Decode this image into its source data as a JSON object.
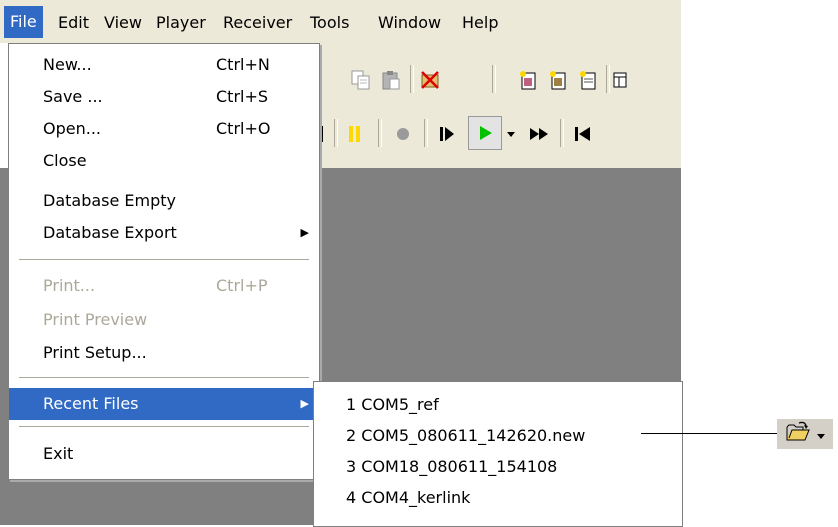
{
  "menubar": {
    "items": [
      "File",
      "Edit",
      "View",
      "Player",
      "Receiver",
      "Tools",
      "Window",
      "Help"
    ]
  },
  "file_menu": {
    "items": [
      {
        "label": "New...",
        "shortcut": "Ctrl+N"
      },
      {
        "label": "Save ...",
        "shortcut": "Ctrl+S"
      },
      {
        "label": "Open...",
        "shortcut": "Ctrl+O"
      },
      {
        "label": "Close",
        "shortcut": ""
      },
      {
        "label": "Database Empty",
        "shortcut": ""
      },
      {
        "label": "Database Export",
        "shortcut": ""
      },
      {
        "label": "Print...",
        "shortcut": "Ctrl+P"
      },
      {
        "label": "Print Preview",
        "shortcut": ""
      },
      {
        "label": "Print Setup...",
        "shortcut": ""
      },
      {
        "label": "Recent Files",
        "shortcut": ""
      },
      {
        "label": "Exit",
        "shortcut": ""
      }
    ]
  },
  "recent_files": [
    "1 COM5_ref",
    "2 COM5_080611_142620.new",
    "3 COM18_080611_154108",
    "4 COM4_kerlink"
  ],
  "colors": {
    "highlight": "#316ac5",
    "disabled": "#aca899",
    "workspace": "#808080",
    "chrome": "#ece9d8"
  },
  "icons": {
    "toolbar_row1": [
      "copy-icon",
      "paste-icon",
      "delete-icon",
      "new-document-icon",
      "new-document-2-icon",
      "new-document-3-icon",
      "panel-icon"
    ],
    "toolbar_row2": [
      "stop-icon",
      "pause-icon",
      "record-icon",
      "step-forward-icon",
      "play-icon",
      "dropdown-icon",
      "fast-forward-icon",
      "go-to-start-icon"
    ],
    "callout": "open-folder-icon"
  }
}
